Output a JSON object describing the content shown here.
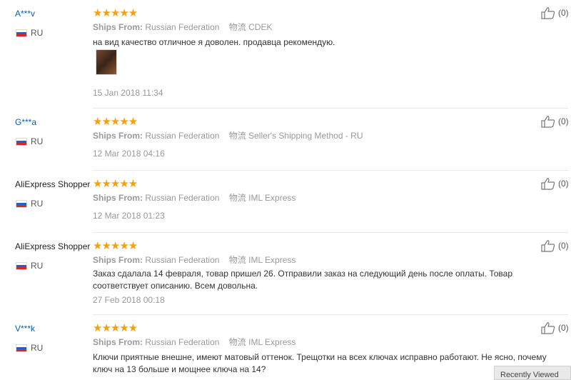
{
  "reviews": [
    {
      "user": "A***v",
      "country": "RU",
      "stars": "★★★★★",
      "ships_from_label": "Ships From:",
      "ships_from": "Russian Federation",
      "logistics_label": "物流",
      "logistics": "CDEK",
      "text": "на вид качество отличное я доволен. продавца рекомендую.",
      "date": "15 Jan 2018 11:34",
      "likes": "(0)",
      "has_photo": true
    },
    {
      "user": "G***a",
      "country": "RU",
      "stars": "★★★★★",
      "ships_from_label": "Ships From:",
      "ships_from": "Russian Federation",
      "logistics_label": "物流",
      "logistics": "Seller's Shipping Method - RU",
      "text": "",
      "date": "12 Mar 2018 04:16",
      "likes": "(0)"
    },
    {
      "user": "AliExpress Shopper",
      "country": "RU",
      "stars": "★★★★★",
      "ships_from_label": "Ships From:",
      "ships_from": "Russian Federation",
      "logistics_label": "物流",
      "logistics": "IML Express",
      "text": "",
      "date": "12 Mar 2018 01:23",
      "likes": "(0)"
    },
    {
      "user": "AliExpress Shopper",
      "country": "RU",
      "stars": "★★★★★",
      "ships_from_label": "Ships From:",
      "ships_from": "Russian Federation",
      "logistics_label": "物流",
      "logistics": "IML Express",
      "text": "Заказ сдалала 14 февраля, товар пришел 26. Отправили заказ на следующий день после оплаты. Товар соответствует описанию. Всем довольна.",
      "date": "27 Feb 2018 00:18",
      "likes": "(0)"
    },
    {
      "user": "V***k",
      "country": "RU",
      "stars": "★★★★★",
      "ships_from_label": "Ships From:",
      "ships_from": "Russian Federation",
      "logistics_label": "物流",
      "logistics": "IML Express",
      "text": "Ключи приятные внешне, имеют матовый оттенок. Трещотки на всех ключах исправно работают. Не ясно, почему ключ на 13 больше и мощнее ключа на 14?",
      "date": "",
      "likes": "(0)"
    }
  ],
  "popup": {
    "label": "Recently Viewed"
  },
  "colors": {
    "star": "#f6a00e",
    "username_link": "#0b5fa5",
    "meta": "#999999"
  }
}
